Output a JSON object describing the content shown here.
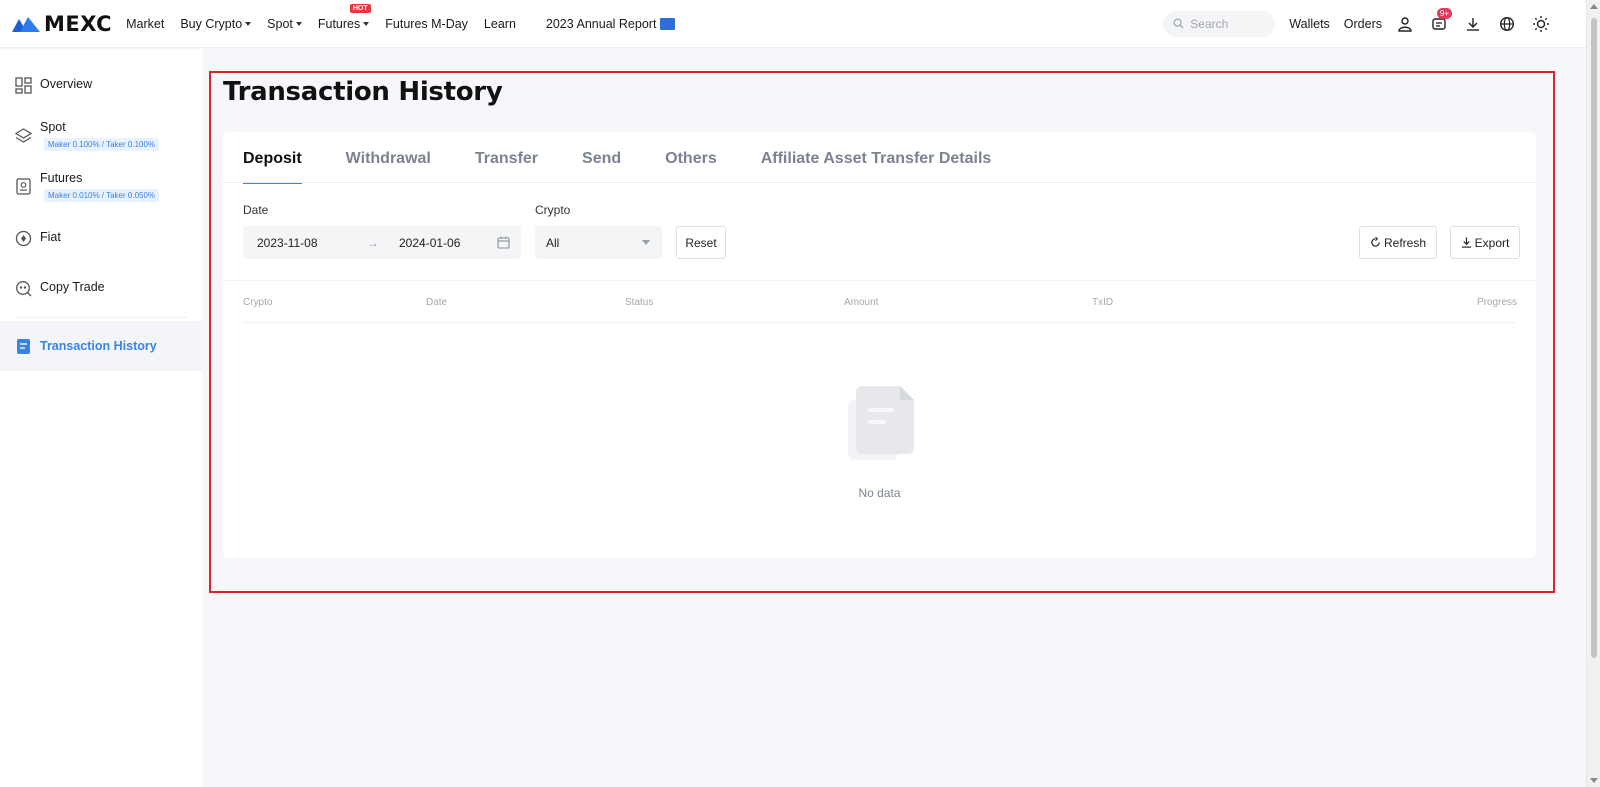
{
  "nav": {
    "brand": "MEXC",
    "items": [
      {
        "label": "Market",
        "caret": false
      },
      {
        "label": "Buy Crypto",
        "caret": true
      },
      {
        "label": "Spot",
        "caret": true
      },
      {
        "label": "Futures",
        "caret": true,
        "badge": "HOT"
      },
      {
        "label": "Futures M-Day",
        "caret": false
      },
      {
        "label": "Learn",
        "caret": false
      },
      {
        "label": "2023 Annual Report",
        "caret": false
      }
    ],
    "search_placeholder": "Search",
    "wallets": "Wallets",
    "orders": "Orders",
    "notification_count": "9+"
  },
  "sidebar": {
    "items": [
      {
        "label": "Overview"
      },
      {
        "label": "Spot",
        "sub": "Maker 0.100% / Taker 0.100%"
      },
      {
        "label": "Futures",
        "sub": "Maker 0.010% / Taker 0.050%"
      },
      {
        "label": "Fiat"
      },
      {
        "label": "Copy Trade"
      },
      {
        "label": "Transaction History",
        "active": true
      }
    ]
  },
  "page": {
    "title": "Transaction History",
    "tabs": [
      {
        "label": "Deposit",
        "active": true
      },
      {
        "label": "Withdrawal"
      },
      {
        "label": "Transfer"
      },
      {
        "label": "Send"
      },
      {
        "label": "Others"
      },
      {
        "label": "Affiliate Asset Transfer Details"
      }
    ],
    "filters": {
      "date_label": "Date",
      "date_from": "2023-11-08",
      "date_arrow": "→",
      "date_to": "2024-01-06",
      "crypto_label": "Crypto",
      "crypto_value": "All",
      "reset": "Reset",
      "refresh": "Refresh",
      "export": "Export"
    },
    "table": {
      "columns": [
        "Crypto",
        "Date",
        "Status",
        "Amount",
        "TxID",
        "Progress"
      ],
      "rows": [],
      "empty_text": "No data"
    }
  },
  "colors": {
    "accent": "#3b82e6",
    "highlight": "#d9252c",
    "hot_badge": "#e5393f"
  }
}
